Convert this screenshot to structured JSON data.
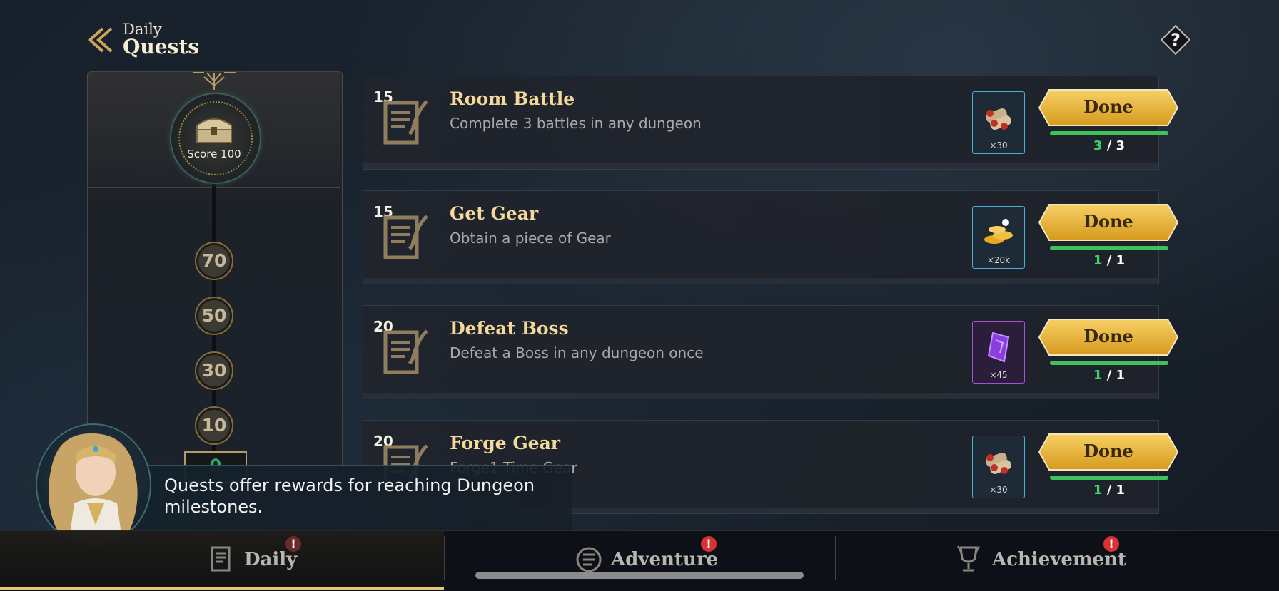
{
  "header": {
    "title_top": "Daily",
    "title_main": "Quests",
    "help_label": "?"
  },
  "score": {
    "label": "Score 100",
    "milestones": [
      "70",
      "50",
      "30",
      "10"
    ],
    "current": "0"
  },
  "quests": [
    {
      "points": "15",
      "name": "Room Battle",
      "desc": "Complete 3 battles in any dungeon",
      "reward_qty": "×30",
      "reward_icon": "scroll-bundle-icon",
      "button": "Done",
      "current": "3",
      "total": "/ 3",
      "progress": 1.0
    },
    {
      "points": "15",
      "name": "Get Gear",
      "desc": "Obtain a piece of Gear",
      "reward_qty": "×20k",
      "reward_icon": "gold-coins-icon",
      "button": "Done",
      "current": "1",
      "total": "/ 1",
      "progress": 1.0
    },
    {
      "points": "20",
      "name": "Defeat Boss",
      "desc": "Defeat a Boss in any dungeon once",
      "reward_qty": "×45",
      "reward_icon": "purple-crystal-icon",
      "button": "Done",
      "current": "1",
      "total": "/ 1",
      "progress": 1.0
    },
    {
      "points": "20",
      "name": "Forge Gear",
      "desc": "Forge1 Time Gear",
      "reward_qty": "×30",
      "reward_icon": "scroll-bundle-icon",
      "button": "Done",
      "current": "1",
      "total": "/ 1",
      "progress": 1.0
    }
  ],
  "dialog": {
    "text": "Quests offer rewards for reaching Dungeon milestones."
  },
  "nav": {
    "tabs": [
      {
        "label": "Daily",
        "badge": "!"
      },
      {
        "label": "Adventure",
        "badge": "!"
      },
      {
        "label": "Achievement",
        "badge": "!"
      }
    ]
  },
  "colors": {
    "accent_gold": "#e8c478",
    "progress_green": "#3ec35c",
    "badge_red": "#d83232"
  }
}
